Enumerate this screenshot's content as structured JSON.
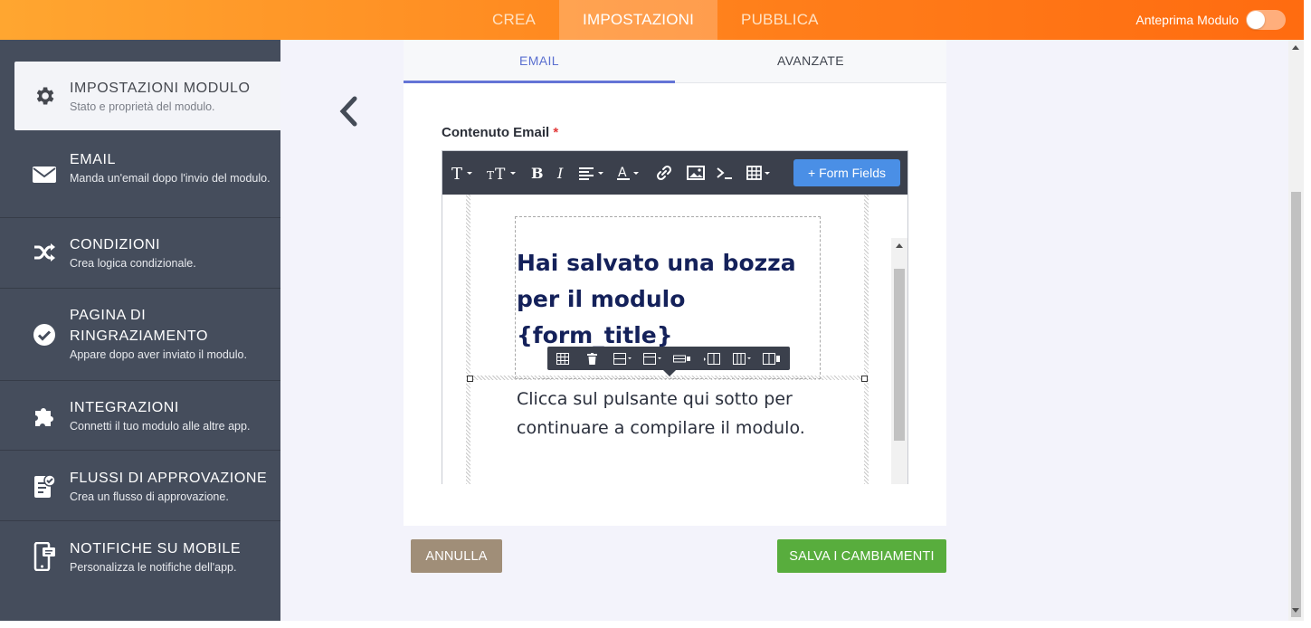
{
  "topbar": {
    "tabs": [
      {
        "label": "CREA",
        "active": false
      },
      {
        "label": "IMPOSTAZIONI",
        "active": true
      },
      {
        "label": "PUBBLICA",
        "active": false
      }
    ],
    "preview_label": "Anteprima Modulo",
    "preview_enabled": false,
    "accent_color": "#ff7e1a"
  },
  "sidebar": {
    "items": [
      {
        "title": "IMPOSTAZIONI MODULO",
        "subtitle": "Stato e proprietà del modulo.",
        "icon": "gear-icon",
        "active": true
      },
      {
        "title": "EMAIL",
        "subtitle": "Manda un'email dopo l'invio del modulo.",
        "icon": "envelope-icon",
        "active": false
      },
      {
        "title": "CONDIZIONI",
        "subtitle": "Crea logica condizionale.",
        "icon": "shuffle-icon",
        "active": false
      },
      {
        "title": "PAGINA DI RINGRAZIAMENTO",
        "subtitle": "Appare dopo aver inviato il modulo.",
        "icon": "check-circle-icon",
        "active": false
      },
      {
        "title": "INTEGRAZIONI",
        "subtitle": "Connetti il tuo modulo alle altre app.",
        "icon": "puzzle-icon",
        "active": false
      },
      {
        "title": "FLUSSI DI APPROVAZIONE",
        "subtitle": "Crea un flusso di approvazione.",
        "icon": "approval-icon",
        "active": false
      },
      {
        "title": "NOTIFICHE SU MOBILE",
        "subtitle": "Personalizza le notifiche dell'app.",
        "icon": "mobile-icon",
        "active": false
      }
    ]
  },
  "card": {
    "tabs": [
      {
        "label": "EMAIL",
        "active": true
      },
      {
        "label": "AVANZATE",
        "active": false
      }
    ],
    "field_label": "Contenuto Email",
    "required_mark": "*"
  },
  "editor": {
    "toolbar": [
      "text-format-icon",
      "text-size-icon",
      "bold-icon",
      "italic-icon",
      "align-icon",
      "font-color-icon",
      "link-icon",
      "image-icon",
      "code-icon",
      "table-icon"
    ],
    "form_fields_label": "+ Form Fields",
    "heading_text": "Hai salvato una bozza per il modulo {form_title}",
    "body_text": "Clicca sul pulsante qui sotto per continuare a compilare il modulo.",
    "table_toolbar": [
      "table-icon",
      "delete-icon",
      "row-insert-icon",
      "row-below-icon",
      "row-delete-icon",
      "col-left-icon",
      "col-right-icon",
      "col-delete-icon"
    ]
  },
  "actions": {
    "cancel_label": "ANNULLA",
    "save_label": "SALVA I CAMBIAMENTI"
  }
}
